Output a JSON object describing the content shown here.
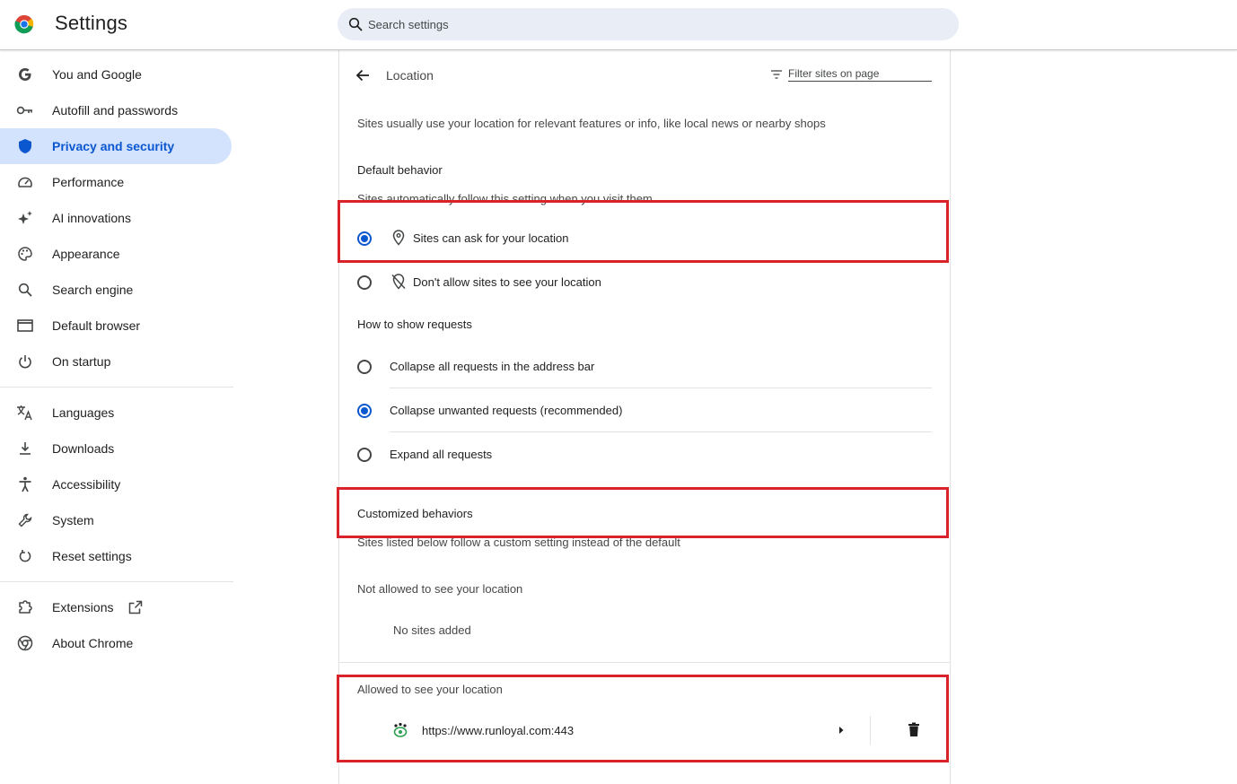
{
  "header": {
    "title": "Settings",
    "search_placeholder": "Search settings"
  },
  "sidebar": {
    "items": [
      {
        "label": "You and Google",
        "icon": "google-g-icon"
      },
      {
        "label": "Autofill and passwords",
        "icon": "key-icon"
      },
      {
        "label": "Privacy and security",
        "icon": "shield-icon",
        "active": true
      },
      {
        "label": "Performance",
        "icon": "speedometer-icon"
      },
      {
        "label": "AI innovations",
        "icon": "sparkle-icon"
      },
      {
        "label": "Appearance",
        "icon": "palette-icon"
      },
      {
        "label": "Search engine",
        "icon": "search-icon"
      },
      {
        "label": "Default browser",
        "icon": "browser-window-icon"
      },
      {
        "label": "On startup",
        "icon": "power-icon"
      },
      {
        "label": "Languages",
        "icon": "translate-icon"
      },
      {
        "label": "Downloads",
        "icon": "download-icon"
      },
      {
        "label": "Accessibility",
        "icon": "accessibility-icon"
      },
      {
        "label": "System",
        "icon": "wrench-icon"
      },
      {
        "label": "Reset settings",
        "icon": "reset-icon"
      },
      {
        "label": "Extensions",
        "icon": "puzzle-icon"
      },
      {
        "label": "About Chrome",
        "icon": "chrome-icon"
      }
    ]
  },
  "location": {
    "title": "Location",
    "filter_placeholder": "Filter sites on page",
    "description": "Sites usually use your location for relevant features or info, like local news or nearby shops",
    "default_behavior": {
      "heading": "Default behavior",
      "subtext": "Sites automatically follow this setting when you visit them",
      "options": [
        {
          "label": "Sites can ask for your location",
          "checked": true,
          "icon": "location-pin-icon"
        },
        {
          "label": "Don't allow sites to see your location",
          "checked": false,
          "icon": "location-off-icon"
        }
      ]
    },
    "requests": {
      "heading": "How to show requests",
      "options": [
        {
          "label": "Collapse all requests in the address bar",
          "checked": false
        },
        {
          "label": "Collapse unwanted requests (recommended)",
          "checked": true
        },
        {
          "label": "Expand all requests",
          "checked": false
        }
      ]
    },
    "customized": {
      "heading": "Customized behaviors",
      "subtext": "Sites listed below follow a custom setting instead of the default",
      "not_allowed_heading": "Not allowed to see your location",
      "not_allowed_empty": "No sites added",
      "allowed_heading": "Allowed to see your location",
      "allowed_sites": [
        {
          "url": "https://www.runloyal.com:443",
          "icon": "site-favicon-icon"
        }
      ]
    }
  },
  "colors": {
    "accent": "#0b57d0",
    "active_nav_bg": "#d3e3fd",
    "highlight_border": "#d9232a"
  }
}
